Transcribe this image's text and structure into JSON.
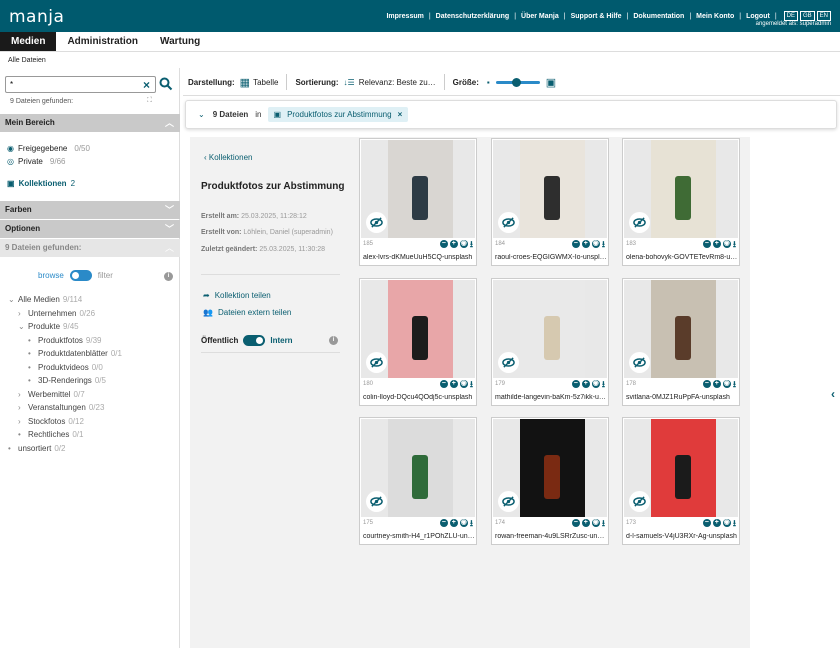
{
  "header": {
    "logo": "manja",
    "nav": [
      "Impressum",
      "Datenschutzerklärung",
      "Über Manja",
      "Support & Hilfe",
      "Dokumentation",
      "Mein Konto",
      "Logout"
    ],
    "languages": [
      "DE",
      "GB",
      "EN"
    ],
    "user_line": "angemeldet als: superadmin"
  },
  "tabs": [
    "Medien",
    "Administration",
    "Wartung"
  ],
  "breadcrumb": "Alle Dateien",
  "search": {
    "value": "*",
    "result_text": "9 Dateien gefunden:"
  },
  "sidebar": {
    "mein_bereich": "Mein Bereich",
    "freigegebene": {
      "label": "Freigegebene",
      "count": "0/50"
    },
    "private": {
      "label": "Private",
      "count": "9/66"
    },
    "kollektionen": {
      "label": "Kollektionen",
      "count": "2"
    },
    "farben": "Farben",
    "optionen": "Optionen",
    "found_section": "9 Dateien gefunden:",
    "browse": "browse",
    "filter": "filter",
    "tree": [
      {
        "arrow": "⌄",
        "label": "Alle Medien",
        "count": "9/114"
      },
      {
        "arrow": "›",
        "label": "Unternehmen",
        "count": "0/26"
      },
      {
        "arrow": "⌄",
        "label": "Produkte",
        "count": "9/45"
      },
      {
        "arrow": "•",
        "label": "Produktfotos",
        "count": "9/39"
      },
      {
        "arrow": "•",
        "label": "Produktdatenblätter",
        "count": "0/1"
      },
      {
        "arrow": "•",
        "label": "Produktvideos",
        "count": "0/0"
      },
      {
        "arrow": "•",
        "label": "3D-Renderings",
        "count": "0/5"
      },
      {
        "arrow": "›",
        "label": "Werbemittel",
        "count": "0/7"
      },
      {
        "arrow": "›",
        "label": "Veranstaltungen",
        "count": "0/23"
      },
      {
        "arrow": "›",
        "label": "Stockfotos",
        "count": "0/12"
      },
      {
        "arrow": "•",
        "label": "Rechtliches",
        "count": "0/1"
      },
      {
        "arrow": "•",
        "label": "unsortiert",
        "count": "0/2"
      }
    ]
  },
  "toolbar": {
    "darstellung_label": "Darstellung:",
    "darstellung_value": "Tabelle",
    "sortierung_label": "Sortierung:",
    "sortierung_value": "Relevanz: Beste zu…",
    "groesse_label": "Größe:",
    "size_level": 0.4
  },
  "filterbar": {
    "count": "9 Dateien",
    "in": "in",
    "chip": "Produktfotos zur Abstimmung"
  },
  "collection": {
    "back": "Kollektionen",
    "title": "Produktfotos zur Abstimmung",
    "created_at_label": "Erstellt am:",
    "created_at": "25.03.2025, 11:28:12",
    "created_by_label": "Erstellt von:",
    "created_by": "Löhlein, Daniel (superadmin)",
    "changed_label": "Zuletzt geändert:",
    "changed": "25.03.2025, 11:30:28",
    "share": "Kollektion teilen",
    "share_ext": "Dateien extern teilen",
    "public_label": "Öffentlich",
    "public_value": "Intern"
  },
  "files": [
    {
      "id": "185",
      "name": "alex-lvrs-dKMueUuH5CQ-unsplash",
      "bg": "#d9d6d2",
      "accent": "#2d3b45"
    },
    {
      "id": "184",
      "name": "raoul-croes-EQGIGWMX-Io-unspl…",
      "bg": "#e9e4dc",
      "accent": "#2e2e2e"
    },
    {
      "id": "183",
      "name": "olena-bohovyk-GOVTETevRm8-u…",
      "bg": "#e7e2d5",
      "accent": "#3f6b35"
    },
    {
      "id": "180",
      "name": "colin-lloyd-DQcu4QOdj5c-unsplash",
      "bg": "#e8a6a8",
      "accent": "#1c1c1c"
    },
    {
      "id": "179",
      "name": "mathilde-langevin-baKm-5z7ikk-u…",
      "bg": "#e9e9e9",
      "accent": "#d6c9b0"
    },
    {
      "id": "178",
      "name": "svitlana-0MJZ1RuPpFA-unsplash",
      "bg": "#c8c0b2",
      "accent": "#5a3c2a"
    },
    {
      "id": "175",
      "name": "courtney-smith-H4_r1POhZLU-un…",
      "bg": "#dcdcdc",
      "accent": "#2f6b3a"
    },
    {
      "id": "174",
      "name": "rowan-freeman-4u9LSRrZusc-un…",
      "bg": "#121212",
      "accent": "#7a2a12"
    },
    {
      "id": "173",
      "name": "d-l-samuels-V4jU3RXr-Ag-unsplash",
      "bg": "#e03b3b",
      "accent": "#1b1b1b"
    }
  ]
}
